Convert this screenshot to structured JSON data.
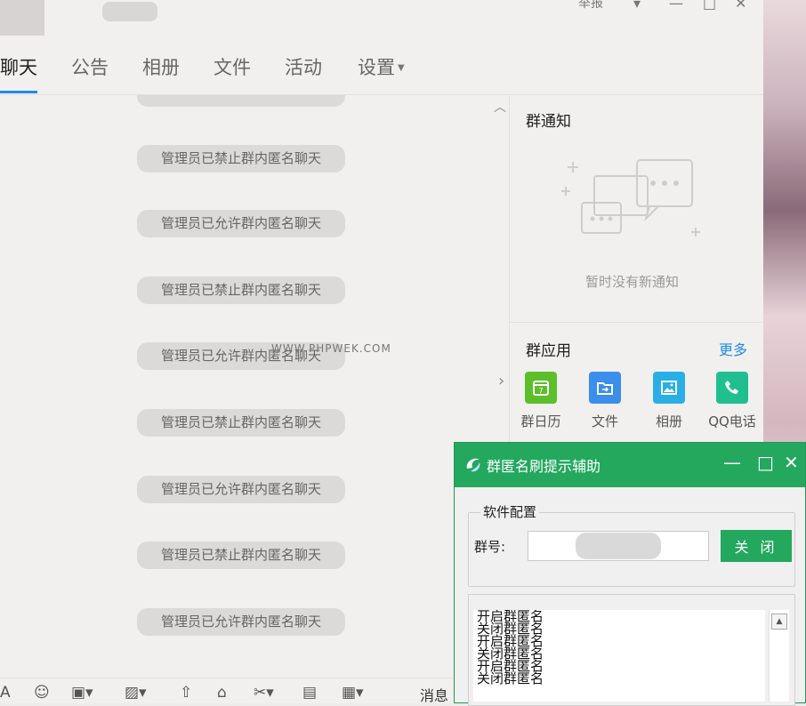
{
  "titlebar": {
    "report": "举报",
    "controls": [
      "▾",
      "—",
      "□",
      "✕"
    ]
  },
  "tabs": [
    {
      "label": "聊天",
      "active": true
    },
    {
      "label": "公告"
    },
    {
      "label": "相册"
    },
    {
      "label": "文件"
    },
    {
      "label": "活动"
    },
    {
      "label": "设置",
      "has_caret": true
    }
  ],
  "chat": {
    "messages": [
      "管理员已禁止群内匿名聊天",
      "管理员已允许群内匿名聊天",
      "管理员已禁止群内匿名聊天",
      "管理员已允许群内匿名聊天",
      "管理员已禁止群内匿名聊天",
      "管理员已允许群内匿名聊天",
      "管理员已禁止群内匿名聊天",
      "管理员已允许群内匿名聊天"
    ],
    "watermark": "WWW.PHPWEK.COM"
  },
  "notice": {
    "title": "群通知",
    "empty": "暂时没有新通知"
  },
  "apps": {
    "title": "群应用",
    "more": "更多",
    "items": [
      {
        "label": "群日历",
        "icon": "calendar-icon",
        "color": "#5cbf2a"
      },
      {
        "label": "文件",
        "icon": "folder-icon",
        "color": "#3b8eea"
      },
      {
        "label": "相册",
        "icon": "photo-icon",
        "color": "#2aaee6"
      },
      {
        "label": "QQ电话",
        "icon": "phone-icon",
        "color": "#1fbf8f"
      }
    ]
  },
  "toolbar": {
    "message_label": "消息"
  },
  "helper": {
    "title": "群匿名刷提示辅助",
    "group_label": "软件配置",
    "qq_label": "群号:",
    "qq_value": "",
    "close_label": "关 闭",
    "log": [
      "开启群匿名",
      "关闭群匿名",
      "开启群匿名",
      "关闭群匿名",
      "开启群匿名",
      "关闭群匿名"
    ],
    "accent": "#23a85e"
  }
}
